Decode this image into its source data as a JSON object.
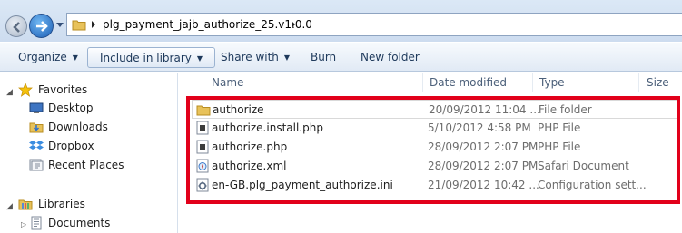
{
  "address_bar": {
    "path_segment": "plg_payment_jajb_authorize_25.v1.0.0"
  },
  "toolbar": {
    "organize": "Organize",
    "include_in_library": "Include in library",
    "share_with": "Share with",
    "burn": "Burn",
    "new_folder": "New folder"
  },
  "nav_pane": {
    "favorites_label": "Favorites",
    "favorites": [
      {
        "label": "Desktop",
        "icon": "desktop-icon"
      },
      {
        "label": "Downloads",
        "icon": "downloads-folder-icon"
      },
      {
        "label": "Dropbox",
        "icon": "dropbox-icon"
      },
      {
        "label": "Recent Places",
        "icon": "recent-places-icon"
      }
    ],
    "libraries_label": "Libraries",
    "libraries": [
      {
        "label": "Documents",
        "icon": "documents-icon"
      }
    ]
  },
  "columns": {
    "name": "Name",
    "date_modified": "Date modified",
    "type": "Type",
    "size": "Size"
  },
  "files": [
    {
      "name": "authorize",
      "date": "20/09/2012 11:04 ...",
      "type": "File folder",
      "icon": "folder-icon"
    },
    {
      "name": "authorize.install.php",
      "date": "5/10/2012 4:58 PM",
      "type": "PHP File",
      "icon": "php-file-icon"
    },
    {
      "name": "authorize.php",
      "date": "28/09/2012 2:07 PM",
      "type": "PHP File",
      "icon": "php-file-icon"
    },
    {
      "name": "authorize.xml",
      "date": "28/09/2012 2:07 PM",
      "type": "Safari Document",
      "icon": "safari-document-icon"
    },
    {
      "name": "en-GB.plg_payment_authorize.ini",
      "date": "21/09/2012 10:42 ...",
      "type": "Configuration sett...",
      "icon": "config-file-icon"
    }
  ],
  "colors": {
    "highlight": "#e2001a",
    "toolbar_text": "#1e395b",
    "header_text": "#4c607a"
  }
}
